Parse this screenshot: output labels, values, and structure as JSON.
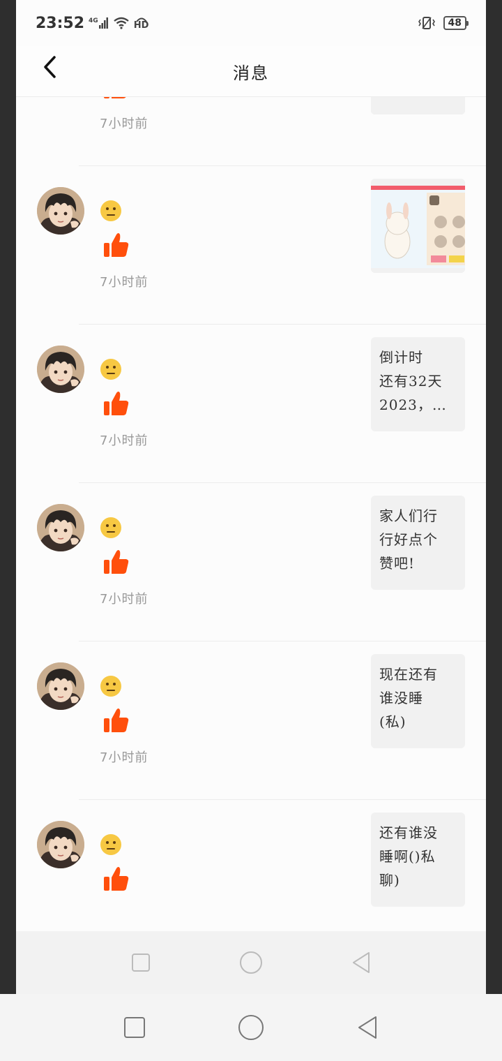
{
  "status": {
    "time": "23:52",
    "network": "4G",
    "hd_label": "HD",
    "battery": "48"
  },
  "header": {
    "title": "消息"
  },
  "notifications": [
    {
      "time": "7小时前",
      "preview_type": "image",
      "preview_text": ""
    },
    {
      "time": "7小时前",
      "preview_type": "image",
      "preview_text": ""
    },
    {
      "time": "7小时前",
      "preview_type": "text",
      "preview_text": "倒计时\n还有32天\n2023，…"
    },
    {
      "time": "7小时前",
      "preview_type": "text",
      "preview_text": "家人们行\n行好点个\n赞吧!"
    },
    {
      "time": "7小时前",
      "preview_type": "text",
      "preview_text": "现在还有\n谁没睡\n(私)"
    },
    {
      "time": "",
      "preview_type": "text",
      "preview_text": "还有谁没\n睡啊()私\n聊)"
    }
  ],
  "colors": {
    "like_orange": "#ff4f0c",
    "emoji_yellow": "#f7c843"
  },
  "icons": {
    "back": "chevron-left-icon",
    "reaction": "neutral-face-emoji",
    "like": "thumbs-up-icon",
    "nav_recents": "square-icon",
    "nav_home": "circle-icon",
    "nav_back": "triangle-back-icon"
  }
}
